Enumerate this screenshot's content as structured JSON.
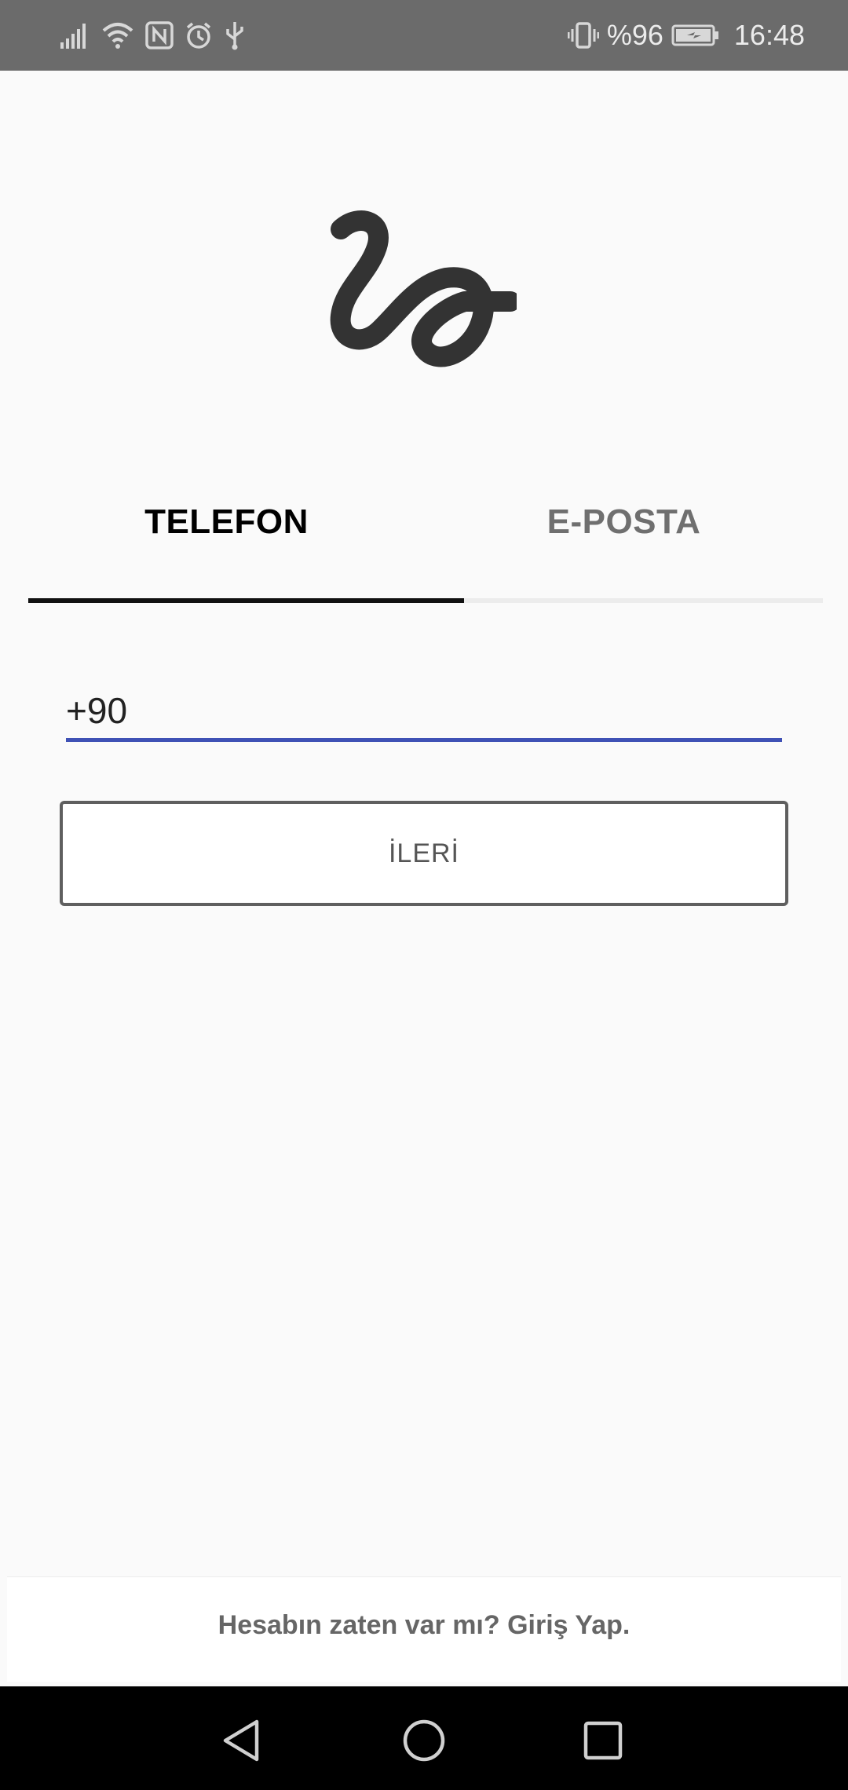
{
  "status_bar": {
    "battery_percent": "%96",
    "time": "16:48",
    "icons": [
      "signal-icon",
      "wifi-icon",
      "nfc-icon",
      "alarm-icon",
      "usb-icon",
      "vibrate-icon",
      "battery-icon"
    ]
  },
  "tabs": [
    {
      "label": "TELEFON",
      "selected": true
    },
    {
      "label": "E-POSTA",
      "selected": false
    }
  ],
  "phone_input": {
    "value": "+90"
  },
  "next_button": {
    "label": "İLERİ"
  },
  "footer": {
    "text": "Hesabın zaten var mı? Giriş Yap."
  },
  "colors": {
    "status_bar": "#6b6b6b",
    "input_underline": "#3f51b5",
    "tab_indicator": "#111111",
    "nav_bar": "#000000"
  },
  "nav_bar": {
    "icons": [
      "back-icon",
      "home-icon",
      "recents-icon"
    ]
  }
}
